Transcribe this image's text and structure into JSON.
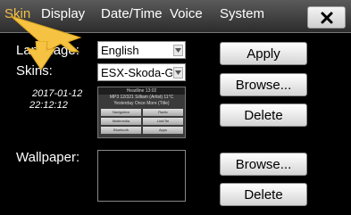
{
  "tabs": [
    {
      "label": "Skin",
      "active": true
    },
    {
      "label": "Display"
    },
    {
      "label": "Date/Time"
    },
    {
      "label": "Voice"
    },
    {
      "label": "System"
    }
  ],
  "close_icon": "close-icon",
  "language": {
    "label": "Language:",
    "value": "English"
  },
  "skins": {
    "label": "Skins:",
    "value": "ESX-Skoda-Gre"
  },
  "timestamp": {
    "date": "2017-01-12",
    "time": "22:12:12"
  },
  "preview": {
    "title": "Headline 13:02",
    "line1": "MP3 12/321     Silliam (Artist)     11°C",
    "line2": "Yesterday Once More (Title)",
    "cells": [
      "Navigation",
      "Radio",
      "Multimedia",
      "Link/Tel",
      "Bluetooth",
      "Apps"
    ]
  },
  "wallpaper": {
    "label": "Wallpaper:"
  },
  "buttons": {
    "apply": "Apply",
    "browse_skin": "Browse...",
    "delete_skin": "Delete",
    "browse_wallpaper": "Browse...",
    "delete_wallpaper": "Delete"
  },
  "colors": {
    "active_tab": "#f3c04a",
    "pointer": "#f5c242"
  }
}
